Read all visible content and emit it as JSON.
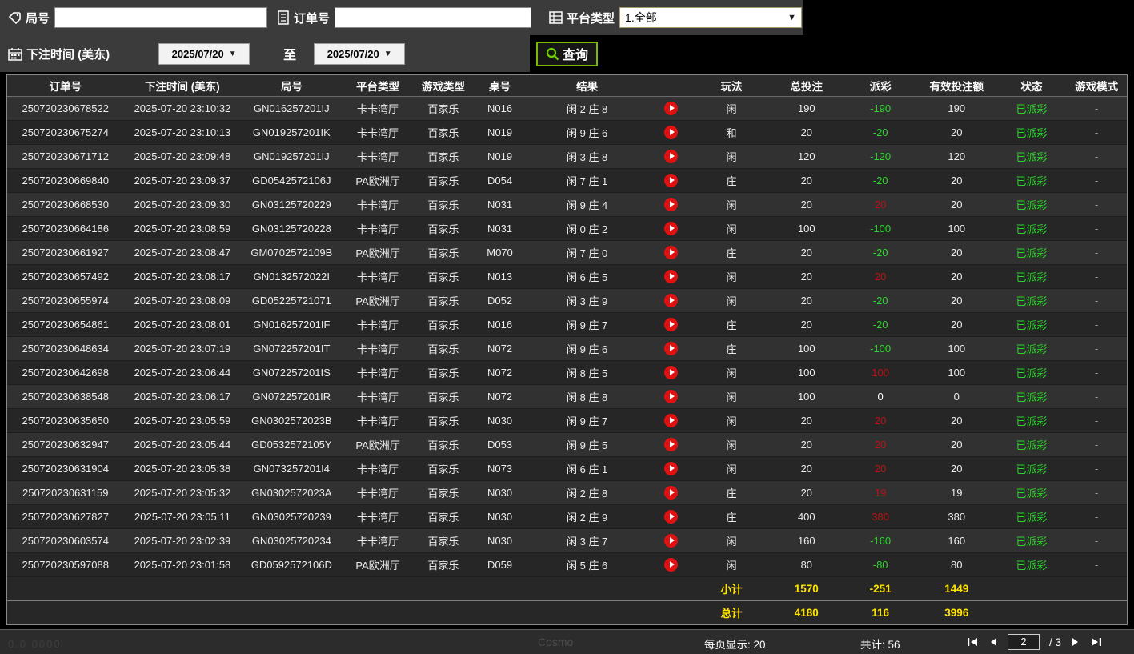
{
  "colors": {
    "pos_red": "#bb1212",
    "neg_green": "#2ed52e",
    "status_green": "#2ed52e",
    "summary_yellow": "#ffe400",
    "query_border_green": "#7fb800",
    "play_button_red": "#df1111"
  },
  "filters": {
    "round_label": "局号",
    "round_value": "",
    "order_label": "订单号",
    "order_value": "",
    "platform_label": "平台类型",
    "platform_value": "1.全部",
    "time_label": "下注时间 (美东)",
    "date_from": "2025/07/20",
    "date_to": "2025/07/20",
    "to_label": "至",
    "query_label": "查询",
    "dropdown_arrow": "▼"
  },
  "table": {
    "headers": [
      {
        "key": "order",
        "label": "订单号"
      },
      {
        "key": "time",
        "label": "下注时间 (美东)"
      },
      {
        "key": "round",
        "label": "局号"
      },
      {
        "key": "platform",
        "label": "平台类型"
      },
      {
        "key": "game",
        "label": "游戏类型"
      },
      {
        "key": "table",
        "label": "桌号"
      },
      {
        "key": "result",
        "label": "结果"
      },
      {
        "key": "replay",
        "label": ""
      },
      {
        "key": "play",
        "label": "玩法"
      },
      {
        "key": "bet",
        "label": "总投注"
      },
      {
        "key": "payout",
        "label": "派彩"
      },
      {
        "key": "valid",
        "label": "有效投注额"
      },
      {
        "key": "status",
        "label": "状态"
      },
      {
        "key": "mode",
        "label": "游戏模式"
      }
    ],
    "rows": [
      {
        "order": "250720230678522",
        "time": "2025-07-20 23:10:32",
        "round": "GN016257201IJ",
        "platform": "卡卡湾厅",
        "game": "百家乐",
        "table_no": "N016",
        "result": "闲 2 庄 8",
        "play": "闲",
        "bet": "190",
        "payout": "-190",
        "valid": "190",
        "status": "已派彩",
        "mode": "-"
      },
      {
        "order": "250720230675274",
        "time": "2025-07-20 23:10:13",
        "round": "GN019257201IK",
        "platform": "卡卡湾厅",
        "game": "百家乐",
        "table_no": "N019",
        "result": "闲 9 庄 6",
        "play": "和",
        "bet": "20",
        "payout": "-20",
        "valid": "20",
        "status": "已派彩",
        "mode": "-"
      },
      {
        "order": "250720230671712",
        "time": "2025-07-20 23:09:48",
        "round": "GN019257201IJ",
        "platform": "卡卡湾厅",
        "game": "百家乐",
        "table_no": "N019",
        "result": "闲 3 庄 8",
        "play": "闲",
        "bet": "120",
        "payout": "-120",
        "valid": "120",
        "status": "已派彩",
        "mode": "-"
      },
      {
        "order": "250720230669840",
        "time": "2025-07-20 23:09:37",
        "round": "GD0542572106J",
        "platform": "PA欧洲厅",
        "game": "百家乐",
        "table_no": "D054",
        "result": "闲 7 庄 1",
        "play": "庄",
        "bet": "20",
        "payout": "-20",
        "valid": "20",
        "status": "已派彩",
        "mode": "-"
      },
      {
        "order": "250720230668530",
        "time": "2025-07-20 23:09:30",
        "round": "GN03125720229",
        "platform": "卡卡湾厅",
        "game": "百家乐",
        "table_no": "N031",
        "result": "闲 9 庄 4",
        "play": "闲",
        "bet": "20",
        "payout": "20",
        "valid": "20",
        "status": "已派彩",
        "mode": "-"
      },
      {
        "order": "250720230664186",
        "time": "2025-07-20 23:08:59",
        "round": "GN03125720228",
        "platform": "卡卡湾厅",
        "game": "百家乐",
        "table_no": "N031",
        "result": "闲 0 庄 2",
        "play": "闲",
        "bet": "100",
        "payout": "-100",
        "valid": "100",
        "status": "已派彩",
        "mode": "-"
      },
      {
        "order": "250720230661927",
        "time": "2025-07-20 23:08:47",
        "round": "GM0702572109B",
        "platform": "PA欧洲厅",
        "game": "百家乐",
        "table_no": "M070",
        "result": "闲 7 庄 0",
        "play": "庄",
        "bet": "20",
        "payout": "-20",
        "valid": "20",
        "status": "已派彩",
        "mode": "-"
      },
      {
        "order": "250720230657492",
        "time": "2025-07-20 23:08:17",
        "round": "GN0132572022I",
        "platform": "卡卡湾厅",
        "game": "百家乐",
        "table_no": "N013",
        "result": "闲 6 庄 5",
        "play": "闲",
        "bet": "20",
        "payout": "20",
        "valid": "20",
        "status": "已派彩",
        "mode": "-"
      },
      {
        "order": "250720230655974",
        "time": "2025-07-20 23:08:09",
        "round": "GD05225721071",
        "platform": "PA欧洲厅",
        "game": "百家乐",
        "table_no": "D052",
        "result": "闲 3 庄 9",
        "play": "闲",
        "bet": "20",
        "payout": "-20",
        "valid": "20",
        "status": "已派彩",
        "mode": "-"
      },
      {
        "order": "250720230654861",
        "time": "2025-07-20 23:08:01",
        "round": "GN016257201IF",
        "platform": "卡卡湾厅",
        "game": "百家乐",
        "table_no": "N016",
        "result": "闲 9 庄 7",
        "play": "庄",
        "bet": "20",
        "payout": "-20",
        "valid": "20",
        "status": "已派彩",
        "mode": "-"
      },
      {
        "order": "250720230648634",
        "time": "2025-07-20 23:07:19",
        "round": "GN072257201IT",
        "platform": "卡卡湾厅",
        "game": "百家乐",
        "table_no": "N072",
        "result": "闲 9 庄 6",
        "play": "庄",
        "bet": "100",
        "payout": "-100",
        "valid": "100",
        "status": "已派彩",
        "mode": "-"
      },
      {
        "order": "250720230642698",
        "time": "2025-07-20 23:06:44",
        "round": "GN072257201IS",
        "platform": "卡卡湾厅",
        "game": "百家乐",
        "table_no": "N072",
        "result": "闲 8 庄 5",
        "play": "闲",
        "bet": "100",
        "payout": "100",
        "valid": "100",
        "status": "已派彩",
        "mode": "-"
      },
      {
        "order": "250720230638548",
        "time": "2025-07-20 23:06:17",
        "round": "GN072257201IR",
        "platform": "卡卡湾厅",
        "game": "百家乐",
        "table_no": "N072",
        "result": "闲 8 庄 8",
        "play": "闲",
        "bet": "100",
        "payout": "0",
        "valid": "0",
        "status": "已派彩",
        "mode": "-"
      },
      {
        "order": "250720230635650",
        "time": "2025-07-20 23:05:59",
        "round": "GN0302572023B",
        "platform": "卡卡湾厅",
        "game": "百家乐",
        "table_no": "N030",
        "result": "闲 9 庄 7",
        "play": "闲",
        "bet": "20",
        "payout": "20",
        "valid": "20",
        "status": "已派彩",
        "mode": "-"
      },
      {
        "order": "250720230632947",
        "time": "2025-07-20 23:05:44",
        "round": "GD0532572105Y",
        "platform": "PA欧洲厅",
        "game": "百家乐",
        "table_no": "D053",
        "result": "闲 9 庄 5",
        "play": "闲",
        "bet": "20",
        "payout": "20",
        "valid": "20",
        "status": "已派彩",
        "mode": "-"
      },
      {
        "order": "250720230631904",
        "time": "2025-07-20 23:05:38",
        "round": "GN073257201I4",
        "platform": "卡卡湾厅",
        "game": "百家乐",
        "table_no": "N073",
        "result": "闲 6 庄 1",
        "play": "闲",
        "bet": "20",
        "payout": "20",
        "valid": "20",
        "status": "已派彩",
        "mode": "-"
      },
      {
        "order": "250720230631159",
        "time": "2025-07-20 23:05:32",
        "round": "GN0302572023A",
        "platform": "卡卡湾厅",
        "game": "百家乐",
        "table_no": "N030",
        "result": "闲 2 庄 8",
        "play": "庄",
        "bet": "20",
        "payout": "19",
        "valid": "19",
        "status": "已派彩",
        "mode": "-"
      },
      {
        "order": "250720230627827",
        "time": "2025-07-20 23:05:11",
        "round": "GN03025720239",
        "platform": "卡卡湾厅",
        "game": "百家乐",
        "table_no": "N030",
        "result": "闲 2 庄 9",
        "play": "庄",
        "bet": "400",
        "payout": "380",
        "valid": "380",
        "status": "已派彩",
        "mode": "-"
      },
      {
        "order": "250720230603574",
        "time": "2025-07-20 23:02:39",
        "round": "GN03025720234",
        "platform": "卡卡湾厅",
        "game": "百家乐",
        "table_no": "N030",
        "result": "闲 3 庄 7",
        "play": "闲",
        "bet": "160",
        "payout": "-160",
        "valid": "160",
        "status": "已派彩",
        "mode": "-"
      },
      {
        "order": "250720230597088",
        "time": "2025-07-20 23:01:58",
        "round": "GD0592572106D",
        "platform": "PA欧洲厅",
        "game": "百家乐",
        "table_no": "D059",
        "result": "闲 5 庄 6",
        "play": "闲",
        "bet": "80",
        "payout": "-80",
        "valid": "80",
        "status": "已派彩",
        "mode": "-"
      }
    ],
    "subtotal": {
      "label": "小计",
      "bet": "1570",
      "payout": "-251",
      "valid": "1449"
    },
    "total": {
      "label": "总计",
      "bet": "4180",
      "payout": "116",
      "valid": "3996"
    }
  },
  "pagination": {
    "per_page_label": "每页显示:",
    "per_page_value": "20",
    "total_label": "共计:",
    "total_value": "56",
    "current_page": "2",
    "page_sep": "/",
    "total_pages": "3"
  },
  "background_hints": {
    "brand": "Cosmo",
    "digits": "0.0 0000"
  }
}
